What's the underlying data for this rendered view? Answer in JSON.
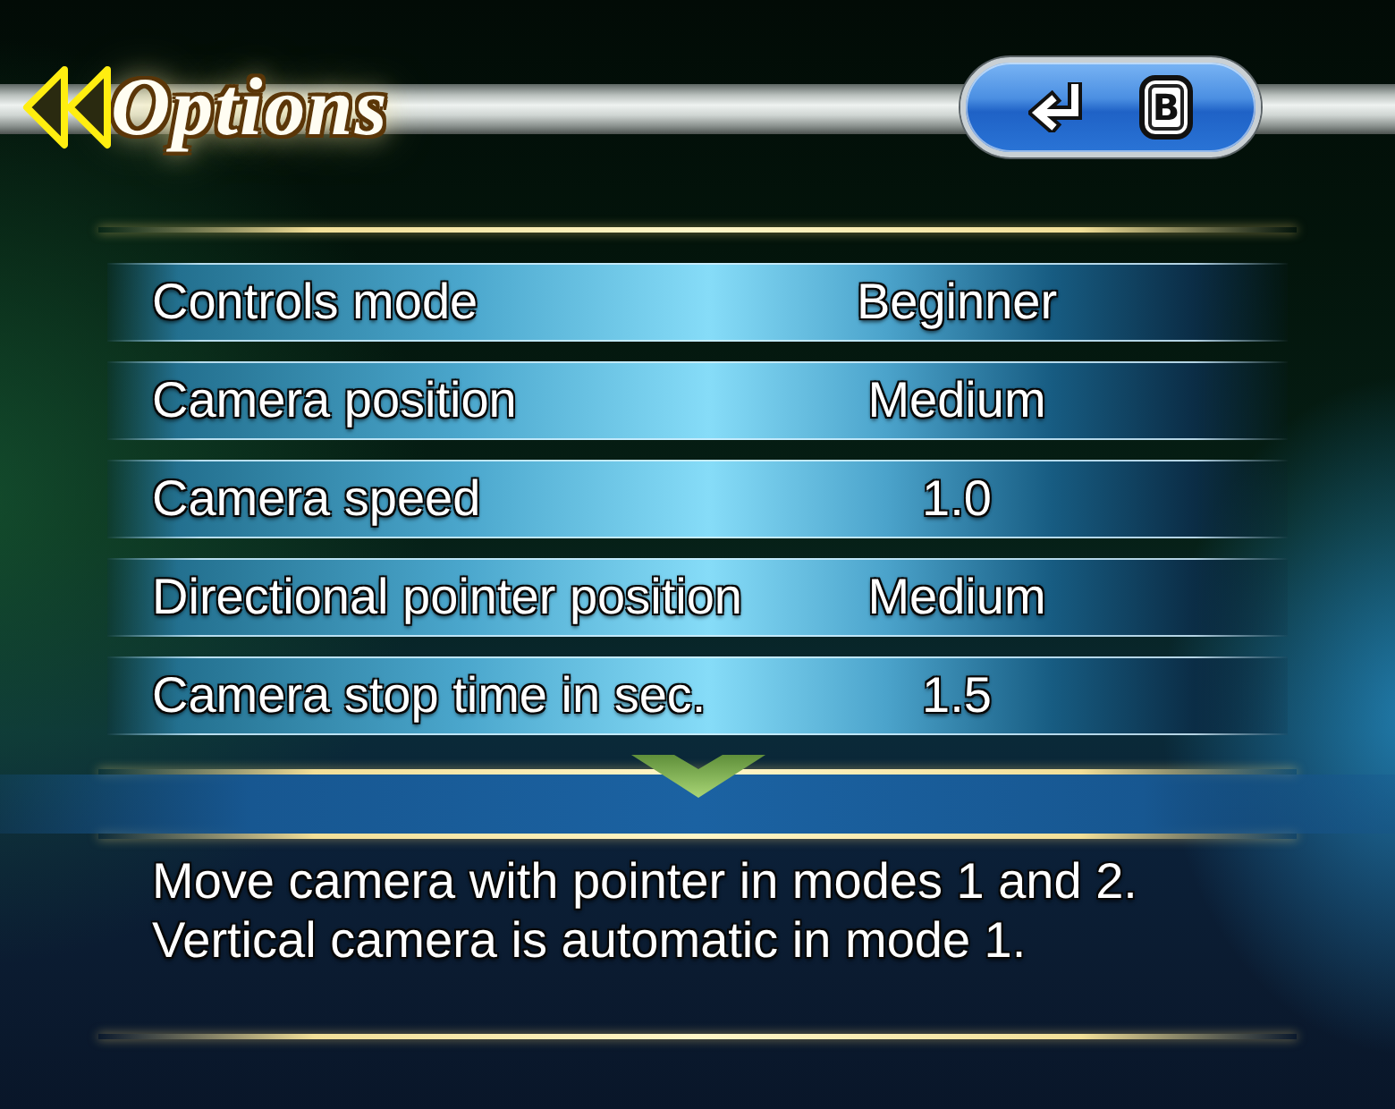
{
  "header": {
    "title": "Options",
    "back_button": {
      "key": "B"
    }
  },
  "settings": [
    {
      "label": "Controls mode",
      "value": "Beginner"
    },
    {
      "label": "Camera position",
      "value": "Medium"
    },
    {
      "label": "Camera speed",
      "value": "1.0"
    },
    {
      "label": "Directional pointer position",
      "value": "Medium"
    },
    {
      "label": "Camera stop time in sec.",
      "value": "1.5"
    }
  ],
  "scroll": {
    "more_below": true
  },
  "description": [
    "Move camera with pointer in modes 1 and 2.",
    "Vertical camera is automatic in mode 1."
  ]
}
